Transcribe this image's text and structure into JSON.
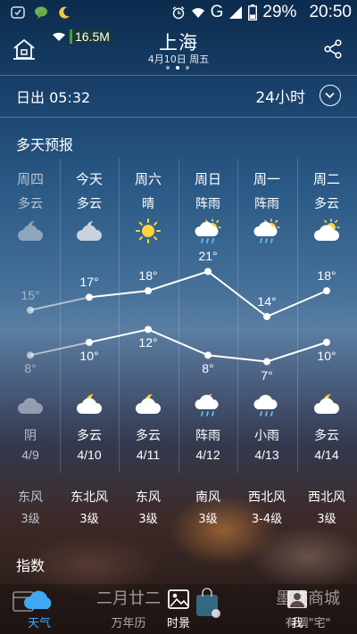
{
  "status_bar": {
    "signal_type": "G",
    "battery": "29%",
    "time": "20:50",
    "network_speed": "16.5M"
  },
  "header": {
    "city": "上海",
    "date": "4月10日 周五",
    "page_dots": 3,
    "active_dot": 1
  },
  "sunrise": {
    "text": "日出 05:32"
  },
  "hourly_toggle": {
    "label": "24小时"
  },
  "forecast_title": "多天预报",
  "index_title": "指数",
  "chart_data": {
    "type": "line",
    "x": [
      "周四",
      "今天",
      "周六",
      "周日",
      "周一",
      "周二"
    ],
    "series": [
      {
        "values": [
          15,
          17,
          18,
          21,
          14,
          18
        ]
      },
      {
        "values": [
          8,
          10,
          12,
          8,
          7,
          10
        ]
      }
    ],
    "ylim": [
      5,
      23
    ]
  },
  "days": [
    {
      "day": "周四",
      "cond_top": "多云",
      "icon_top": "cloudy-night-icon",
      "high": "15°",
      "low": "8°",
      "cond_bottom": "阴",
      "icon_bottom": "overcast-icon",
      "date": "4/9",
      "wind_dir": "东风",
      "wind_lvl": "3级",
      "past": true
    },
    {
      "day": "今天",
      "cond_top": "多云",
      "icon_top": "cloudy-night-icon",
      "high": "17°",
      "low": "10°",
      "cond_bottom": "多云",
      "icon_bottom": "partly-cloudy-night-icon",
      "date": "4/10",
      "wind_dir": "东北风",
      "wind_lvl": "3级",
      "past": false
    },
    {
      "day": "周六",
      "cond_top": "晴",
      "icon_top": "sun-icon",
      "high": "18°",
      "low": "12°",
      "cond_bottom": "多云",
      "icon_bottom": "partly-cloudy-night-icon",
      "date": "4/11",
      "wind_dir": "东风",
      "wind_lvl": "3级",
      "past": false
    },
    {
      "day": "周日",
      "cond_top": "阵雨",
      "icon_top": "shower-icon",
      "high": "21°",
      "low": "8°",
      "cond_bottom": "阵雨",
      "icon_bottom": "shower-night-icon",
      "date": "4/12",
      "wind_dir": "南风",
      "wind_lvl": "3级",
      "past": false
    },
    {
      "day": "周一",
      "cond_top": "阵雨",
      "icon_top": "shower-icon",
      "high": "14°",
      "low": "7°",
      "cond_bottom": "小雨",
      "icon_bottom": "light-rain-icon",
      "date": "4/13",
      "wind_dir": "西北风",
      "wind_lvl": "3-4级",
      "past": false
    },
    {
      "day": "周二",
      "cond_top": "多云",
      "icon_top": "partly-cloudy-icon",
      "high": "18°",
      "low": "10°",
      "cond_bottom": "多云",
      "icon_bottom": "partly-cloudy-night-icon",
      "date": "4/14",
      "wind_dir": "西北风",
      "wind_lvl": "3级",
      "past": false
    }
  ],
  "bottom_nav": [
    {
      "label": "天气",
      "icon": "weather-cloud-icon",
      "active": true
    },
    {
      "label": "二月廿二",
      "sub": "万年历",
      "icon": "calendar-icon",
      "active": false
    },
    {
      "label": "时景",
      "icon": "photo-icon",
      "active": false
    },
    {
      "label": "墨迹商城",
      "sub": "有调\"宅\"",
      "icon": "shopping-bag-icon",
      "active": false
    },
    {
      "label": "我",
      "icon": "person-icon",
      "active": false
    }
  ],
  "colors": {
    "accent_blue": "#3fa9f5",
    "sun_yellow": "#ffd23f",
    "line_white": "#ffffff"
  }
}
